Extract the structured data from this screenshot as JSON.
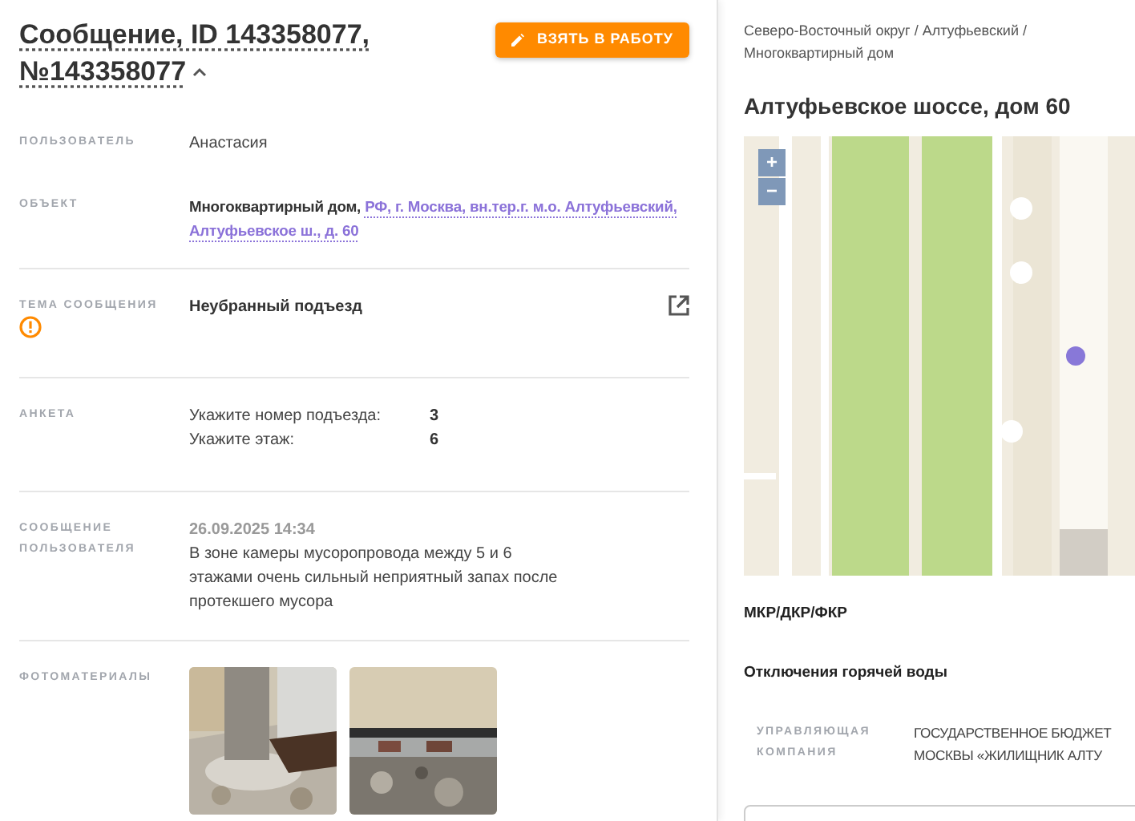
{
  "header": {
    "title_line1": "Сообщение, ID 143358077,",
    "title_line2": "№143358077",
    "expanded": true,
    "action_button": "ВЗЯТЬ В РАБОТУ"
  },
  "fields": [
    {
      "kind": "text",
      "label": "ПОЛЬЗОВАТЕЛЬ",
      "value": "Анастасия"
    },
    {
      "kind": "object",
      "label": "ОБЪЕКТ",
      "object_type": "Многоквартирный дом,",
      "address": "РФ, г. Москва, вн.тер.г. м.о. Алтуфьевский, Алтуфьевское ш., д. 60"
    },
    {
      "kind": "topic",
      "label": "ТЕМА СООБЩЕНИЯ",
      "value": "Неубранный подъезд"
    },
    {
      "kind": "survey",
      "label": "АНКЕТА",
      "answers": [
        {
          "question": "Укажите номер подъезда:",
          "answer": "3"
        },
        {
          "question": "Укажите этаж:",
          "answer": "6"
        }
      ]
    },
    {
      "kind": "message",
      "label": "СООБЩЕНИЕ ПОЛЬЗОВАТЕЛЯ",
      "date": "26.09.2025 14:34",
      "text": "В зоне камеры мусоропровода между 5 и 6 этажами очень сильный неприятный запах после протекшего мусора"
    },
    {
      "kind": "photos",
      "label": "ФОТОМАТЕРИАЛЫ"
    }
  ],
  "building": {
    "breadcrumb": "Северо-Восточный округ / Алтуфьевский / Многоквартирный дом",
    "title": "Алтуфьевское шоссе, дом 60",
    "map": {
      "kind": "picture",
      "zoom_in": "+",
      "zoom_out": "−"
    },
    "sections": [
      "МКР/ДКР/ФКР",
      "Отключения горячей воды"
    ],
    "management": {
      "label": "УПРАВЛЯЮЩАЯ КОМПАНИЯ",
      "value_lines": [
        "ГОСУДАРСТВЕННОЕ БЮДЖЕТ",
        "МОСКВЫ «ЖИЛИЩНИК АЛТУ"
      ]
    }
  }
}
